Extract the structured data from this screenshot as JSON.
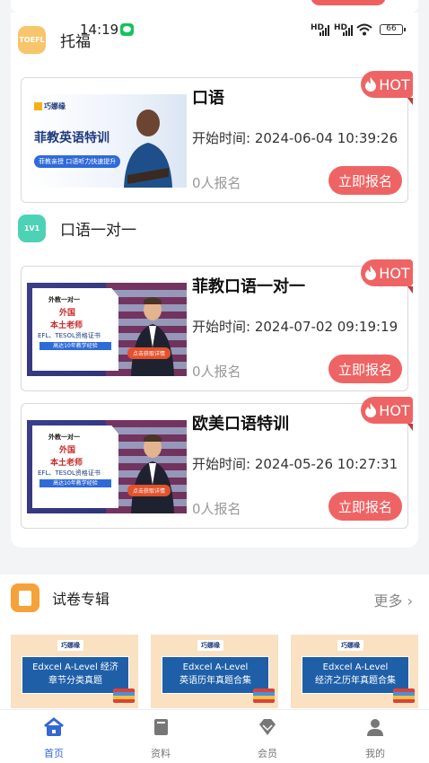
{
  "status_bar": {
    "time": "14:19",
    "network_1": "HD",
    "network_2": "HD",
    "battery": "66"
  },
  "sections": [
    {
      "icon_text": "TOEFL",
      "icon_color": "#f7c56b",
      "title": "托福",
      "courses": [
        {
          "title": "口语",
          "start_time": "开始时间: 2024-06-04 10:39:26",
          "enrolled": "0人报名",
          "button": "立即报名",
          "hot": "HOT",
          "thumb": {
            "brand": "巧娜缘",
            "headline": "菲教英语特训",
            "subline": "菲教亲授 口语听力快速提升"
          }
        }
      ]
    },
    {
      "icon_text": "1V1",
      "icon_color": "#4ed2b6",
      "title": "口语一对一",
      "courses": [
        {
          "title": "菲教口语一对一",
          "start_time": "开始时间: 2024-07-02 09:19:19",
          "enrolled": "0人报名",
          "button": "立即报名",
          "hot": "HOT",
          "thumb": {
            "p1": "外教一对一",
            "p2": "外国",
            "p3": "本土老师",
            "p4": "EFL、TESOL资格证书",
            "p5": "高达10年教学经验",
            "cta": "点击获取详情"
          }
        },
        {
          "title": "欧美口语特训",
          "start_time": "开始时间: 2024-05-26 10:27:31",
          "enrolled": "0人报名",
          "button": "立即报名",
          "hot": "HOT",
          "thumb": {
            "p1": "外教一对一",
            "p2": "外国",
            "p3": "本土老师",
            "p4": "EFL、TESOL资格证书",
            "p5": "高达10年教学经验",
            "cta": "点击获取详情"
          }
        }
      ]
    }
  ],
  "exam": {
    "title": "试卷专辑",
    "more": "更多",
    "albums": [
      {
        "logo": "巧娜缘",
        "line1": "Edxcel A-Level 经济",
        "line2": "章节分类真题"
      },
      {
        "logo": "巧娜缘",
        "line1": "Edxcel A-Level",
        "line2": "英语历年真题合集"
      },
      {
        "logo": "巧娜缘",
        "line1": "Edxcel A-Level",
        "line2": "经济之历年真题合集"
      }
    ]
  },
  "tabbar": [
    {
      "label": "首页",
      "icon": "home-icon",
      "active": true
    },
    {
      "label": "资料",
      "icon": "book-icon",
      "active": false
    },
    {
      "label": "会员",
      "icon": "diamond-icon",
      "active": false
    },
    {
      "label": "我的",
      "icon": "user-icon",
      "active": false
    }
  ],
  "colors": {
    "accent": "#ee6464",
    "tab_active": "#3367d6",
    "exam_icon": "#f5a23a"
  }
}
